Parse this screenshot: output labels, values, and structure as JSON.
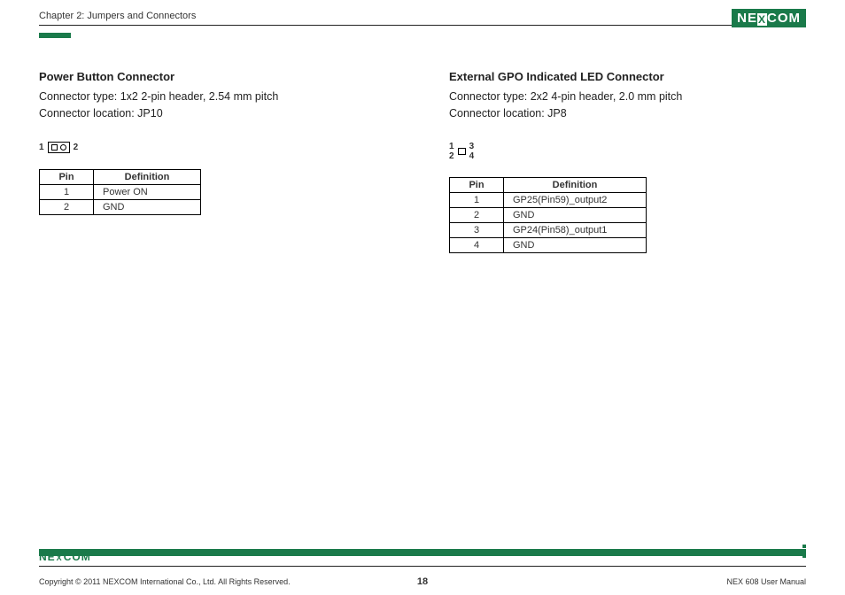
{
  "header": {
    "chapter": "Chapter 2: Jumpers and Connectors",
    "logo_left": "NE",
    "logo_x": "X",
    "logo_right": "COM"
  },
  "sections": {
    "left": {
      "title": "Power Button Connector",
      "line1": "Connector type: 1x2 2-pin header, 2.54 mm pitch",
      "line2": "Connector location: JP10",
      "diagram": {
        "l1": "1",
        "l2": "2"
      },
      "table": {
        "h1": "Pin",
        "h2": "Definition",
        "rows": [
          {
            "pin": "1",
            "def": "Power ON"
          },
          {
            "pin": "2",
            "def": "GND"
          }
        ]
      }
    },
    "right": {
      "title": "External GPO Indicated LED Connector",
      "line1": "Connector type: 2x2 4-pin header, 2.0 mm pitch",
      "line2": "Connector location: JP8",
      "diagram": {
        "l1": "1",
        "l2": "2",
        "l3": "3",
        "l4": "4"
      },
      "table": {
        "h1": "Pin",
        "h2": "Definition",
        "rows": [
          {
            "pin": "1",
            "def": "GP25(Pin59)_output2"
          },
          {
            "pin": "2",
            "def": "GND"
          },
          {
            "pin": "3",
            "def": "GP24(Pin58)_output1"
          },
          {
            "pin": "4",
            "def": "GND"
          }
        ]
      }
    }
  },
  "footer": {
    "copyright": "Copyright © 2011 NEXCOM International Co., Ltd. All Rights Reserved.",
    "page": "18",
    "manual": "NEX 608 User Manual",
    "logo_left": "NE",
    "logo_x": "X",
    "logo_right": "COM"
  }
}
